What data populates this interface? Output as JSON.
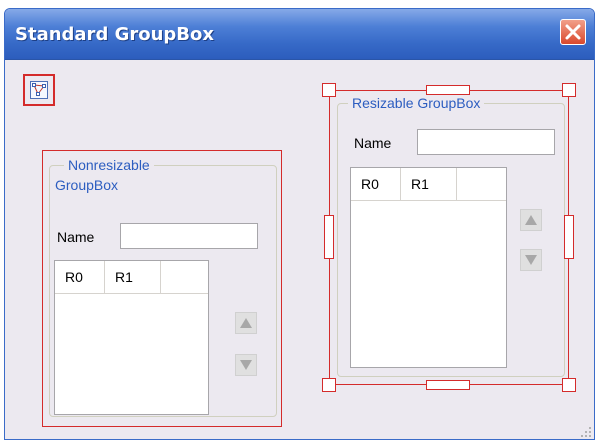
{
  "window": {
    "title": "Standard GroupBox"
  },
  "icons": {
    "close": "close-icon",
    "tool": "connector-nodes-icon",
    "up": "triangle-up-icon",
    "down": "triangle-down-icon",
    "grip": "resize-grip-icon"
  },
  "colors": {
    "title_bar": "#3669c7",
    "selection": "#d42b2b",
    "group_title": "#2c5dc0",
    "window_bg": "#ece9f0"
  },
  "nonresizable_groupbox": {
    "title_line1": "Nonresizable",
    "title_line2": "GroupBox",
    "name_label": "Name",
    "name_value": "",
    "columns": [
      "R0",
      "R1"
    ]
  },
  "resizable_groupbox": {
    "title": "Resizable GroupBox",
    "name_label": "Name",
    "name_value": "",
    "columns": [
      "R0",
      "R1"
    ]
  }
}
